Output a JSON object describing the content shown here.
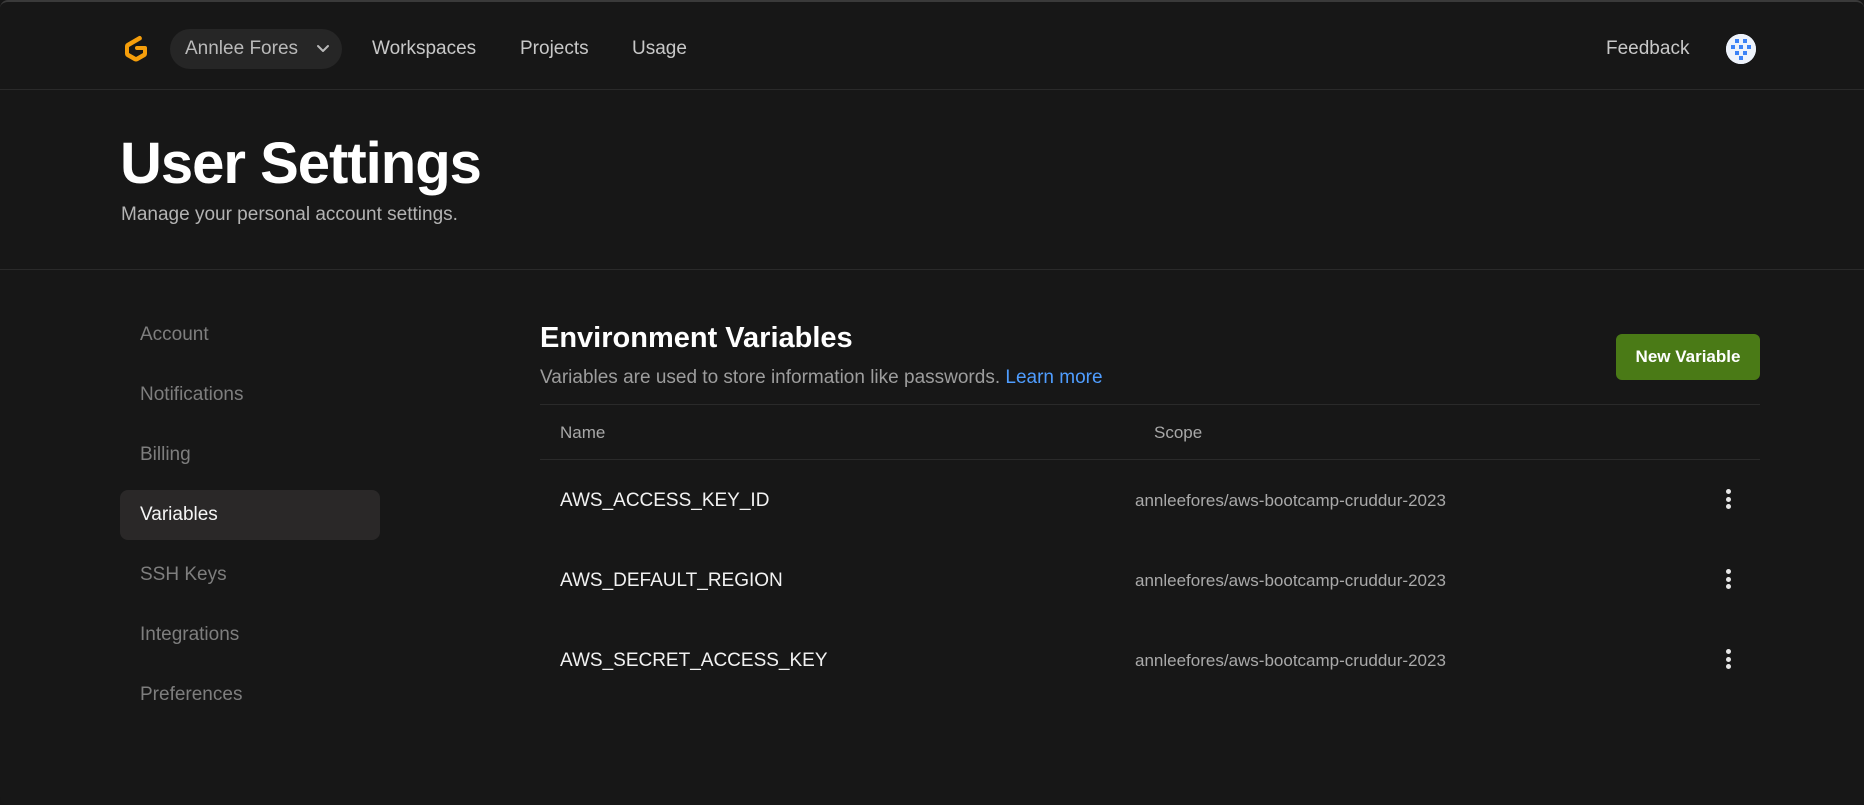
{
  "nav": {
    "team_name": "Annlee Fores",
    "links": [
      "Workspaces",
      "Projects",
      "Usage"
    ],
    "feedback": "Feedback",
    "brand_color": "#f59e0b"
  },
  "header": {
    "title": "User Settings",
    "subtitle": "Manage your personal account settings."
  },
  "sidebar": {
    "items": [
      {
        "label": "Account",
        "active": false
      },
      {
        "label": "Notifications",
        "active": false
      },
      {
        "label": "Billing",
        "active": false
      },
      {
        "label": "Variables",
        "active": true
      },
      {
        "label": "SSH Keys",
        "active": false
      },
      {
        "label": "Integrations",
        "active": false
      },
      {
        "label": "Preferences",
        "active": false
      }
    ]
  },
  "main": {
    "title": "Environment Variables",
    "description": "Variables are used to store information like passwords.",
    "learn_more": "Learn more",
    "new_button": "New Variable",
    "columns": {
      "name": "Name",
      "scope": "Scope"
    },
    "rows": [
      {
        "name": "AWS_ACCESS_KEY_ID",
        "scope": "annleefores/aws-bootcamp-cruddur-2023"
      },
      {
        "name": "AWS_DEFAULT_REGION",
        "scope": "annleefores/aws-bootcamp-cruddur-2023"
      },
      {
        "name": "AWS_SECRET_ACCESS_KEY",
        "scope": "annleefores/aws-bootcamp-cruddur-2023"
      }
    ]
  }
}
